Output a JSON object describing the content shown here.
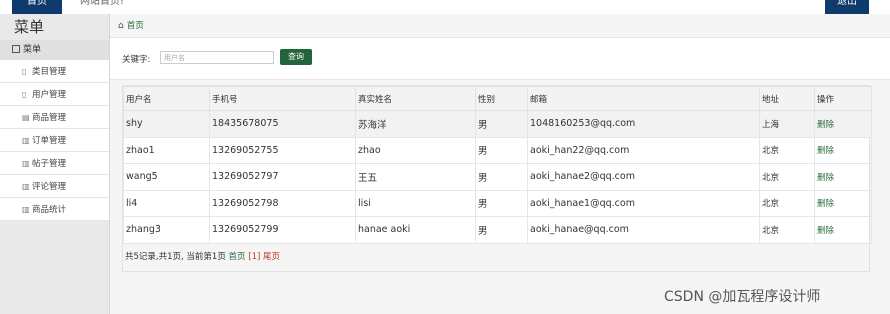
{
  "topbar": {
    "home_label": "首页",
    "site_home_label": "网站首页!",
    "logout_label": "退出"
  },
  "sidebar": {
    "title": "菜单",
    "menu_head": "菜单",
    "items": [
      {
        "label": "类目管理",
        "icon": "file-icon"
      },
      {
        "label": "用户管理",
        "icon": "file-icon"
      },
      {
        "label": "商品管理",
        "icon": "list-icon"
      },
      {
        "label": "订单管理",
        "icon": "book-icon"
      },
      {
        "label": "帖子管理",
        "icon": "book-icon"
      },
      {
        "label": "评论管理",
        "icon": "book-icon"
      },
      {
        "label": "商品统计",
        "icon": "book-icon"
      }
    ]
  },
  "breadcrumb": {
    "home": "首页"
  },
  "search": {
    "label": "关键字:",
    "placeholder": "用户名",
    "button": "查询"
  },
  "table": {
    "headers": [
      "用户名",
      "手机号",
      "真实姓名",
      "性别",
      "邮箱",
      "地址",
      "操作"
    ],
    "rows": [
      {
        "username": "shy",
        "phone": "18435678075",
        "realname": "苏海洋",
        "gender": "男",
        "email": "1048160253@qq.com",
        "address": "上海",
        "action": "删除"
      },
      {
        "username": "zhao1",
        "phone": "13269052755",
        "realname": "zhao",
        "gender": "男",
        "email": "aoki_han22@qq.com",
        "address": "北京",
        "action": "删除"
      },
      {
        "username": "wang5",
        "phone": "13269052797",
        "realname": "王五",
        "gender": "男",
        "email": "aoki_hanae2@qq.com",
        "address": "北京",
        "action": "删除"
      },
      {
        "username": "li4",
        "phone": "13269052798",
        "realname": "lisi",
        "gender": "男",
        "email": "aoki_hanae1@qq.com",
        "address": "北京",
        "action": "删除"
      },
      {
        "username": "zhang3",
        "phone": "13269052799",
        "realname": "hanae aoki",
        "gender": "男",
        "email": "aoki_hanae@qq.com",
        "address": "北京",
        "action": "删除"
      }
    ]
  },
  "pager": {
    "summary": "共5记录,共1页, 当前第1页",
    "first": "首页",
    "current": "[1]",
    "last": "尾页"
  },
  "watermark": "CSDN @加瓦程序设计师"
}
